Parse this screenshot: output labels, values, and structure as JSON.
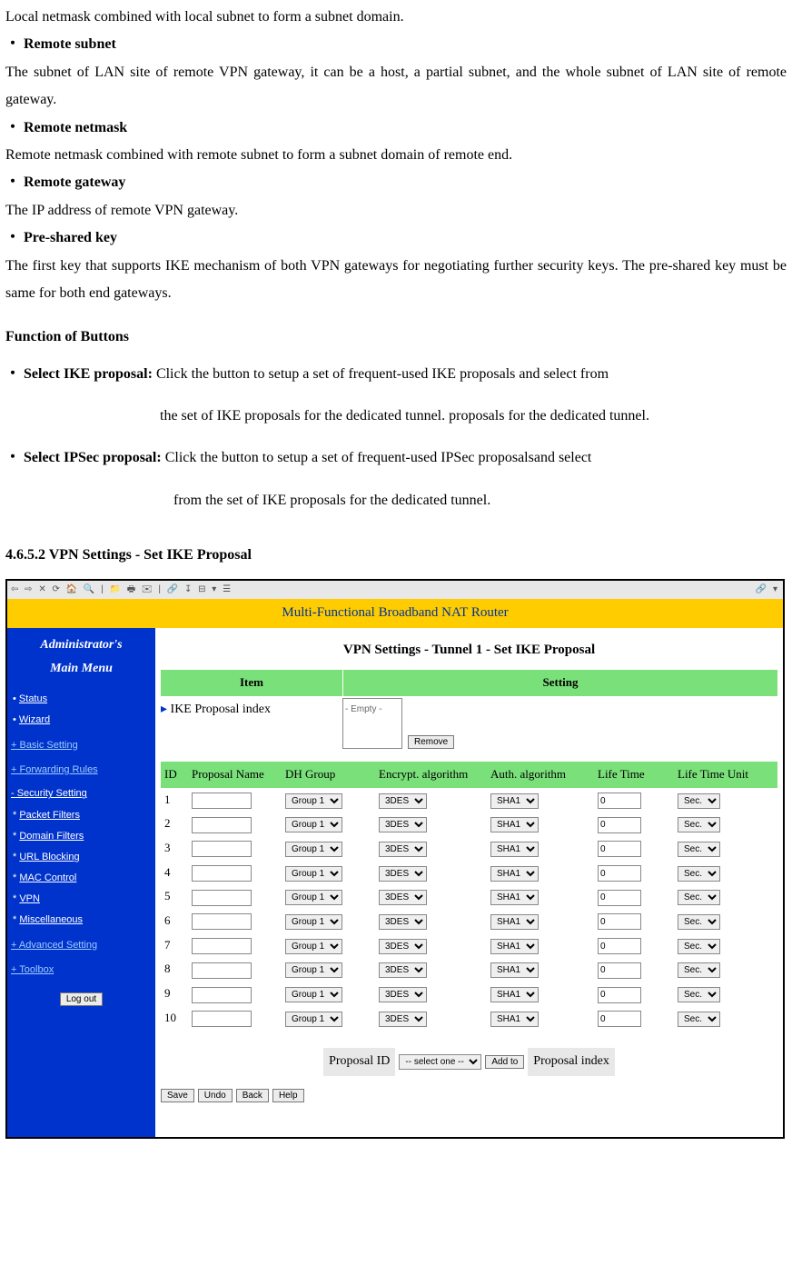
{
  "doc": {
    "netmask_intro": "Local netmask combined with local subnet to form a subnet domain.",
    "b1": "・ Remote subnet",
    "t1": "The subnet of LAN site of remote VPN gateway, it can be a host, a partial subnet, and the whole subnet of LAN site of remote gateway.",
    "b2": "・ Remote netmask",
    "t2": "Remote netmask combined with remote subnet to form a subnet domain of remote end.",
    "b3": "・ Remote gateway",
    "t3": "The IP address of remote VPN gateway.",
    "b4": "・ Pre-shared key",
    "t4": "The first key that supports IKE mechanism of both VPN gateways for negotiating further security keys. The pre-shared key must be same for both end gateways.",
    "fob": "Function of Buttons",
    "ike_b": "・ Select IKE proposal: ",
    "ike_t1": "Click the button to setup a set of frequent-used IKE proposals and select from",
    "ike_t2": "the set of IKE proposals for the dedicated tunnel. proposals for the dedicated tunnel.",
    "ips_b": "・ Select IPSec proposal: ",
    "ips_t1": "Click the button to setup a set of frequent-used IPSec proposalsand select",
    "ips_t2": "from the set of IKE proposals for the dedicated tunnel.",
    "h4": "4.6.5.2 VPN Settings - Set IKE Proposal"
  },
  "ui": {
    "toolbar_left": "⇦ ⇨ ✕ ⟳ 🏠 🔍 | 📁 🖶 ✉ | 🔗 ↧ ⊟ ▾ ☰",
    "toolbar_right": "🔗 ▾",
    "banner": "Multi-Functional Broadband NAT Router",
    "admin_title1": "Administrator's",
    "admin_title2": "Main Menu",
    "nav": {
      "status": "Status",
      "wizard": "Wizard",
      "basic": "+ Basic Setting",
      "fwd": "+ Forwarding Rules",
      "sec": "- Security Setting",
      "pf": "Packet Filters",
      "df": "Domain Filters",
      "ub": "URL Blocking",
      "mc": "MAC Control",
      "vpn": "VPN",
      "misc": "Miscellaneous",
      "adv": "+ Advanced Setting",
      "tool": "+ Toolbox"
    },
    "logout": "Log out",
    "main_title": "VPN Settings - Tunnel 1 - Set IKE Proposal",
    "hdr_item": "Item",
    "hdr_setting": "Setting",
    "ike_index_label": "IKE Proposal index",
    "empty": "- Empty -",
    "remove": "Remove",
    "cols": {
      "id": "ID",
      "name": "Proposal Name",
      "dh": "DH Group",
      "enc": "Encrypt. algorithm",
      "auth": "Auth. algorithm",
      "life": "Life Time",
      "unit": "Life Time Unit"
    },
    "row_ids": [
      "1",
      "2",
      "3",
      "4",
      "5",
      "6",
      "7",
      "8",
      "9",
      "10"
    ],
    "defaults": {
      "dh": "Group 1",
      "enc": "3DES",
      "auth": "SHA1",
      "life": "0",
      "unit": "Sec."
    },
    "proposal_id_label": "Proposal ID",
    "proposal_sel": "-- select one --",
    "addto": "Add to",
    "proposal_index_label": "Proposal index",
    "save": "Save",
    "undo": "Undo",
    "back": "Back",
    "help": "Help"
  }
}
